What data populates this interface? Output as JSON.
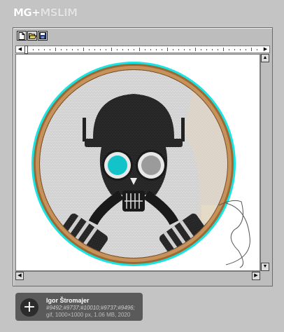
{
  "brand": {
    "logo_main": "MG+",
    "logo_faded": "MSLIM"
  },
  "toolbar": {
    "buttons": [
      "new-file-icon",
      "open-folder-icon",
      "save-disk-icon"
    ]
  },
  "artwork": {
    "subject": "cross-stitch gas mask skull in embroidery hoop",
    "colors": {
      "hoop": "#b8844a",
      "hoop_glow": "#00d8d8",
      "fabric": "#ececec",
      "mask": "#1a1a1a",
      "lens_left": "#11c3c9",
      "lens_right": "#9a9a9a"
    }
  },
  "info": {
    "author": "Igor Štromajer",
    "tags": "#9492;#9737;#10010;#9737;#9496;",
    "meta": "gif, 1000×1000 px, 1.06 MB, 2020"
  },
  "scroll": {
    "up": "▲",
    "down": "▼",
    "left": "◀",
    "right": "▶"
  }
}
